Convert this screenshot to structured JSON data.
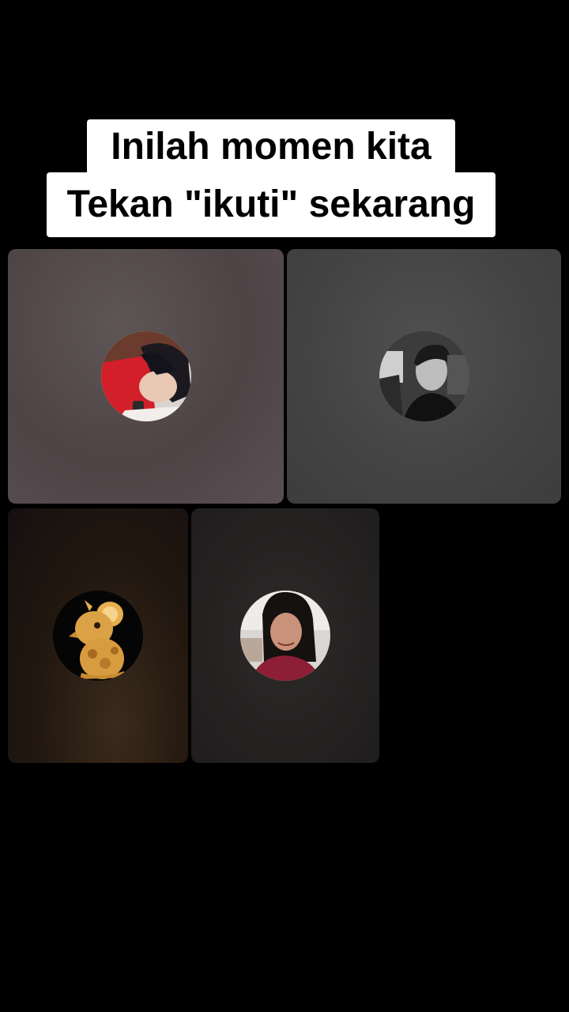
{
  "caption": {
    "line1": "Inilah momen kita",
    "line2": "Tekan \"ikuti\" sekarang"
  },
  "participants": [
    {
      "avatar_icon": "woman-red-shirt-avatar-icon"
    },
    {
      "avatar_icon": "man-monochrome-avatar-icon"
    },
    {
      "avatar_icon": "golden-mouse-figurine-avatar-icon"
    },
    {
      "avatar_icon": "woman-smiling-avatar-icon"
    }
  ]
}
